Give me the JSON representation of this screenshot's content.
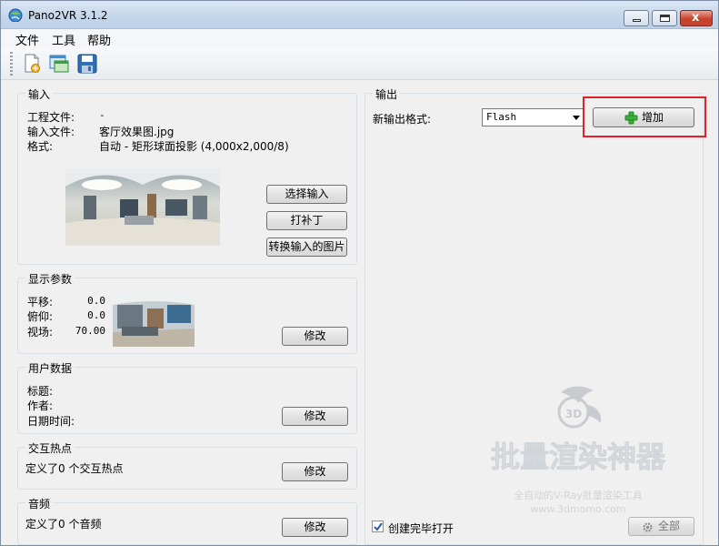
{
  "window": {
    "title": "Pano2VR 3.1.2",
    "close_glyph": "x"
  },
  "menu": {
    "file": "文件",
    "tools": "工具",
    "help": "帮助"
  },
  "toolbar": {
    "icons": [
      "new-project-icon",
      "open-project-icon",
      "save-icon"
    ]
  },
  "input": {
    "group_title": "输入",
    "project_file_label": "工程文件:",
    "project_file_value": "-",
    "input_file_label": "输入文件:",
    "input_file_value": "客厅效果图.jpg",
    "format_label": "格式:",
    "format_value": "自动 - 矩形球面投影 (4,000x2,000/8)",
    "select_input_button": "选择输入",
    "patch_button": "打补丁",
    "convert_button": "转换输入的图片"
  },
  "display": {
    "group_title": "显示参数",
    "pan_label": "平移:",
    "pan_value": "0.0",
    "tilt_label": "俯仰:",
    "tilt_value": "0.0",
    "fov_label": "视场:",
    "fov_value": "70.00",
    "modify_button": "修改"
  },
  "user_data": {
    "group_title": "用户数据",
    "title_label": "标题:",
    "author_label": "作者:",
    "datetime_label": "日期时间:",
    "modify_button": "修改"
  },
  "hotspots": {
    "group_title": "交互热点",
    "summary": "定义了0 个交互热点",
    "modify_button": "修改"
  },
  "audio": {
    "group_title": "音频",
    "summary": "定义了0 个音频",
    "modify_button": "修改"
  },
  "output": {
    "group_title": "输出",
    "new_format_label": "新输出格式:",
    "format_selected": "Flash",
    "add_button": "增加",
    "open_after_create": "创建完毕打开",
    "open_after_create_checked": true,
    "all_button": "全部"
  },
  "watermark": {
    "logo_text": "3D",
    "title": "批量渲染神器",
    "line1": "全自动的V-Ray批量渲染工具",
    "line2": "www.3dmomo.com"
  },
  "colors": {
    "highlight": "#e0222b",
    "add_icon": "#3cae3c"
  }
}
